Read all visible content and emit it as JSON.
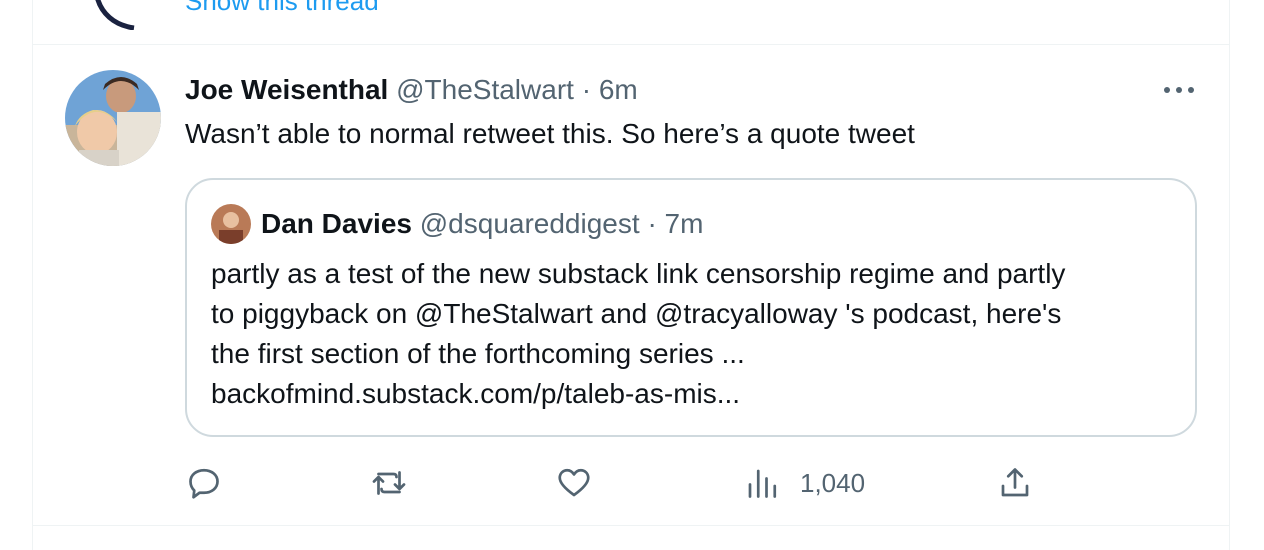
{
  "thread": {
    "show_thread_label": "Show this thread"
  },
  "tweet": {
    "author_name": "Joe Weisenthal",
    "author_handle": "@TheStalwart",
    "separator": "·",
    "timestamp": "6m",
    "text": "Wasn’t able to normal retweet this. So here’s a quote tweet"
  },
  "quoted": {
    "author_name": "Dan Davies",
    "author_handle": "@dsquareddigest",
    "separator": "·",
    "timestamp": "7m",
    "lines": [
      "partly as a test of the new substack link censorship regime and partly",
      "to piggyback on @TheStalwart and @tracyalloway 's podcast, here's",
      "the first section of the forthcoming series ...",
      "backofmind.substack.com/p/taleb-as-mis..."
    ]
  },
  "actions": {
    "reply_icon": "reply-icon",
    "retweet_icon": "retweet-icon",
    "like_icon": "heart-icon",
    "views_icon": "views-chart-icon",
    "views_count": "1,040",
    "share_icon": "share-icon"
  },
  "colors": {
    "accent": "#1d9bf0",
    "text": "#0f1419",
    "muted": "#536471",
    "border": "#cfd9de"
  }
}
